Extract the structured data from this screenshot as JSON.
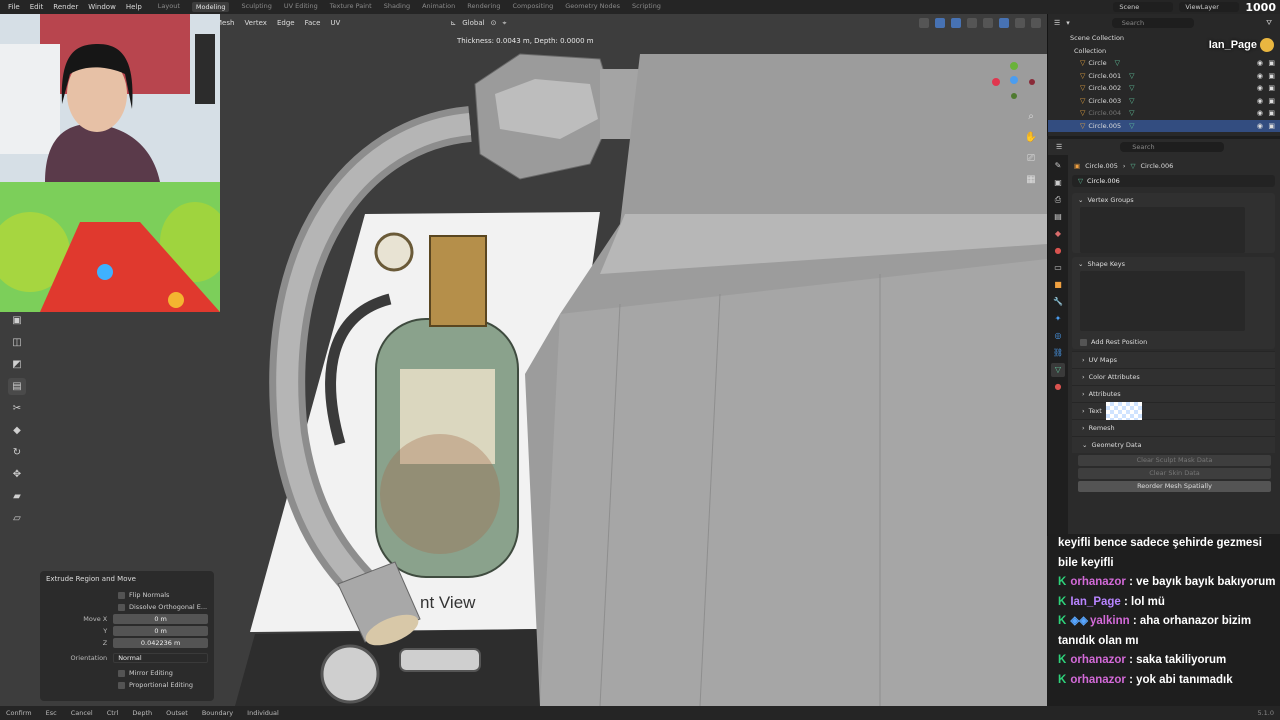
{
  "topbar": {
    "menu": [
      "File",
      "Edit",
      "Render",
      "Window",
      "Help"
    ],
    "workspaces": [
      "Layout",
      "Modeling",
      "Sculpting",
      "UV Editing",
      "Texture Paint",
      "Shading",
      "Animation",
      "Rendering",
      "Compositing",
      "Geometry Nodes",
      "Scripting"
    ],
    "active_workspace": "Modeling",
    "scene": "Scene",
    "view_layer": "ViewLayer",
    "counter": "1000"
  },
  "viewport": {
    "menus": [
      "Mesh",
      "Vertex",
      "Edge",
      "Face",
      "UV"
    ],
    "orientation": "Global",
    "hint": "Thickness: 0.0043 m, Depth:  0.0000 m",
    "reference_label": "nt View"
  },
  "operator_panel": {
    "title": "Extrude Region and Move",
    "flip_normals": "Flip Normals",
    "dissolve": "Dissolve Orthogonal E...",
    "move_label": "Move X",
    "move_x": "0 m",
    "y_label": "Y",
    "move_y": "0 m",
    "z_label": "Z",
    "move_z": "0.042236 m",
    "orientation_label": "Orientation",
    "orientation_value": "Normal",
    "mirror_editing": "Mirror Editing",
    "proportional_editing": "Proportional Editing"
  },
  "outliner": {
    "search_placeholder": "Search",
    "scene_collection": "Scene Collection",
    "collection": "Collection",
    "items": [
      "Circle",
      "Circle.001",
      "Circle.002",
      "Circle.003",
      "Circle.004",
      "Circle.005"
    ]
  },
  "properties": {
    "search_placeholder": "Search",
    "object_name": "Circle.005",
    "mesh_name": "Circle.006",
    "data_name": "Circle.006",
    "vertex_groups": "Vertex Groups",
    "shape_keys": "Shape Keys",
    "add_rest_position": "Add Rest Position",
    "uv_maps": "UV Maps",
    "color_attributes": "Color Attributes",
    "attributes": "Attributes",
    "texture_space": "Text",
    "remesh": "Remesh",
    "geometry_data": "Geometry Data",
    "clear_sculpt": "Clear Sculpt Mask Data",
    "clear_skin": "Clear Skin Data",
    "reorder_mesh": "Reorder Mesh Spatially"
  },
  "statusbar": {
    "items": [
      "Confirm",
      "Esc",
      "Cancel",
      "Ctrl",
      "Depth",
      "Outset",
      "Boundary",
      "Individual"
    ],
    "version": "5.1.0"
  },
  "streamer": "Ian_Page",
  "chat": {
    "messages": [
      {
        "user": "",
        "text": "keyifli bence sadece şehirde gezmesi bile keyifli"
      },
      {
        "user": "orhanazor",
        "text": "ve bayık bayık bakıyorum"
      },
      {
        "user": "Ian_Page",
        "text": "lol mü"
      },
      {
        "user": "yalkinn",
        "text": "aha orhanazor bizim tanıdık olan mı"
      },
      {
        "user": "orhanazor",
        "text": "saka takiliyorum"
      },
      {
        "user": "orhanazor",
        "text": "yok abi tanımadık"
      }
    ]
  }
}
